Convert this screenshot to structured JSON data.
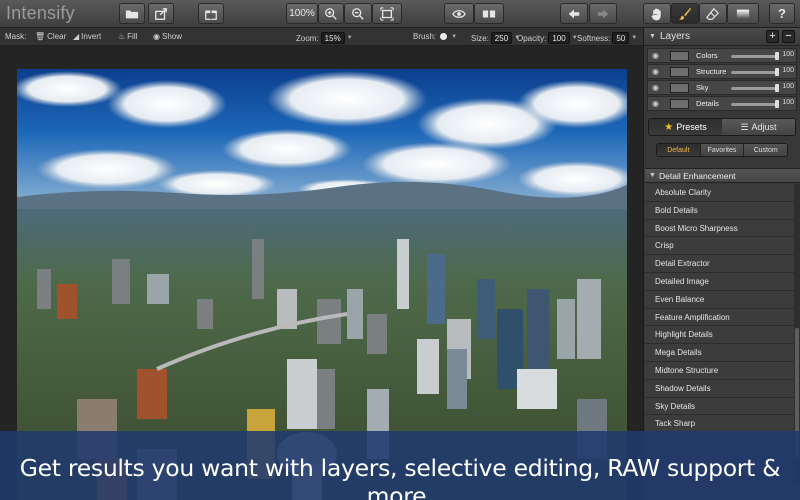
{
  "app": {
    "title": "Intensify"
  },
  "toolbar": {
    "zoom_value": "100%",
    "icons": [
      "open-folder-icon",
      "share-icon",
      "gift-icon",
      "zoom-in-icon",
      "zoom-out-icon",
      "fit-screen-icon",
      "eye-icon",
      "compare-icon",
      "undo-icon",
      "redo-icon",
      "hand-icon",
      "brush-icon",
      "eraser-icon",
      "gradient-icon",
      "help-icon"
    ],
    "help_label": "?"
  },
  "options": {
    "mask_label": "Mask:",
    "clear_label": "Clear",
    "invert_label": "Invert",
    "fill_label": "Fill",
    "show_label": "Show",
    "zoom_label": "Zoom:",
    "zoom_value": "15%",
    "brush_label": "Brush:",
    "size_label": "Size:",
    "size_value": "250",
    "opacity_label": "Opacity:",
    "opacity_value": "100",
    "softness_label": "Softness:",
    "softness_value": "50"
  },
  "layers": {
    "title": "Layers",
    "add_label": "+",
    "remove_label": "−",
    "items": [
      {
        "name": "Colors",
        "value": "100",
        "opacity": 1.0
      },
      {
        "name": "Structure",
        "value": "100",
        "opacity": 1.0
      },
      {
        "name": "Sky",
        "value": "100",
        "opacity": 1.0
      },
      {
        "name": "Details",
        "value": "100",
        "opacity": 1.0
      }
    ]
  },
  "mode_tabs": {
    "presets": "Presets",
    "adjust": "Adjust",
    "selected": "presets"
  },
  "preset_tabs": {
    "items": [
      "Default",
      "Favorites",
      "Custom"
    ],
    "selected": "Default"
  },
  "presets": {
    "category": "Detail Enhancement",
    "items": [
      "Absolute Clarity",
      "Bold Details",
      "Boost Micro Sharpness",
      "Crisp",
      "Detail Extractor",
      "Detailed Image",
      "Even Balance",
      "Feature Amplification",
      "Highlight Details",
      "Mega Details",
      "Midtone Structure",
      "Shadow Details",
      "Sky Details",
      "Tack Sharp"
    ]
  },
  "caption": {
    "text": "Get results you want with layers, selective editing, RAW support & more."
  },
  "colors": {
    "caption_bg": "#203a6e",
    "accent_star": "#f0c020",
    "selected_tab_text": "#f5b94a"
  }
}
